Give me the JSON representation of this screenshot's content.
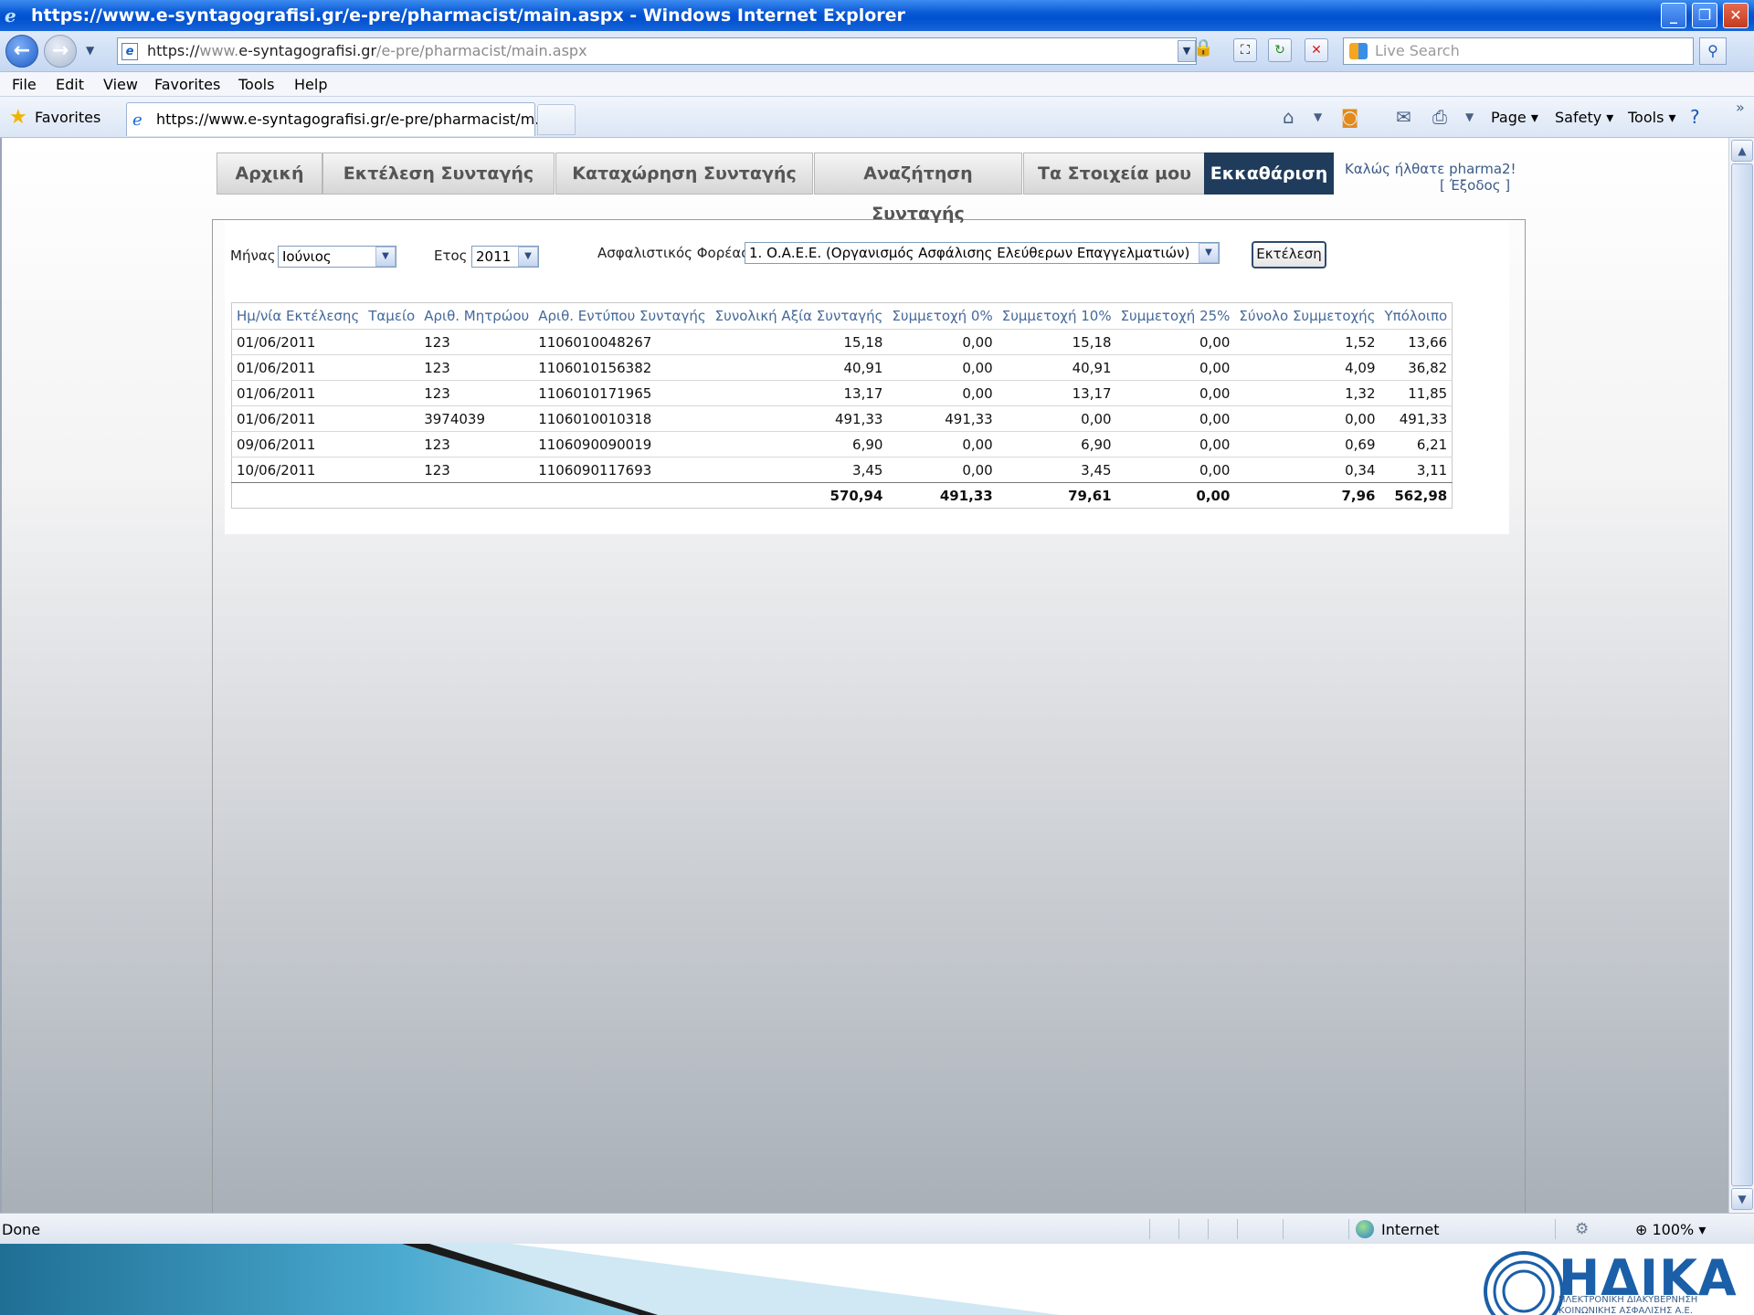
{
  "window": {
    "title": "https://www.e-syntagografisi.gr/e-pre/pharmacist/main.aspx - Windows Internet Explorer"
  },
  "address": {
    "scheme": "https://",
    "host": "www.e-syntagografisi.gr",
    "path": "/e-pre/pharmacist/main.aspx"
  },
  "search": {
    "placeholder": "Live Search"
  },
  "menu": [
    "File",
    "Edit",
    "View",
    "Favorites",
    "Tools",
    "Help"
  ],
  "favorites": {
    "label": "Favorites",
    "tab_title": "https://www.e-syntagografisi.gr/e-pre/pharmacist/m..."
  },
  "commandbar": {
    "page": "Page ▾",
    "safety": "Safety ▾",
    "tools": "Tools ▾"
  },
  "app": {
    "tabs": [
      "Αρχική",
      "Εκτέλεση Συνταγής",
      "Καταχώρηση Συνταγής",
      "Αναζήτηση Συνταγής",
      "Τα Στοιχεία μου",
      "Εκκαθάριση"
    ],
    "active_tab": "Εκκαθάριση",
    "welcome": "Καλώς ήλθατε pharma2!",
    "logout": "[ Έξοδος ]"
  },
  "filters": {
    "month_label": "Μήνας",
    "month_value": "Ιούνιος",
    "year_label": "Ετος",
    "year_value": "2011",
    "insurer_label": "Ασφαλιστικός Φορέας",
    "insurer_value": "1. Ο.Α.Ε.Ε. (Οργανισμός Ασφάλισης Ελεύθερων Επαγγελματιών)",
    "execute_label": "Εκτέλεση"
  },
  "table": {
    "headers": [
      "Ημ/νία Εκτέλεσης",
      "Ταμείο",
      "Αριθ. Μητρώου",
      "Αριθ. Εντύπου Συνταγής",
      "Συνολική Αξία Συνταγής",
      "Συμμετοχή 0%",
      "Συμμετοχή 10%",
      "Συμμετοχή 25%",
      "Σύνολο Συμμετοχής",
      "Υπόλοιπο"
    ],
    "rows": [
      [
        "01/06/2011",
        "",
        "123",
        "1106010048267",
        "15,18",
        "0,00",
        "15,18",
        "0,00",
        "1,52",
        "13,66"
      ],
      [
        "01/06/2011",
        "",
        "123",
        "1106010156382",
        "40,91",
        "0,00",
        "40,91",
        "0,00",
        "4,09",
        "36,82"
      ],
      [
        "01/06/2011",
        "",
        "123",
        "1106010171965",
        "13,17",
        "0,00",
        "13,17",
        "0,00",
        "1,32",
        "11,85"
      ],
      [
        "01/06/2011",
        "",
        "3974039",
        "1106010010318",
        "491,33",
        "491,33",
        "0,00",
        "0,00",
        "0,00",
        "491,33"
      ],
      [
        "09/06/2011",
        "",
        "123",
        "1106090090019",
        "6,90",
        "0,00",
        "6,90",
        "0,00",
        "0,69",
        "6,21"
      ],
      [
        "10/06/2011",
        "",
        "123",
        "1106090117693",
        "3,45",
        "0,00",
        "3,45",
        "0,00",
        "0,34",
        "3,11"
      ]
    ],
    "totals": [
      "",
      "",
      "",
      "",
      "570,94",
      "491,33",
      "79,61",
      "0,00",
      "7,96",
      "562,98"
    ]
  },
  "status": {
    "text": "Done",
    "zone": "Internet",
    "zoom": "100%"
  },
  "footer": {
    "brand": "ΗΔΙΚΑ",
    "sub1": "ΗΛΕΚΤΡΟΝΙΚΗ ΔΙΑΚΥΒΕΡΝΗΣΗ",
    "sub2": "ΚΟΙΝΩΝΙΚΗΣ ΑΣΦΑΛΙΣΗΣ Α.Ε."
  }
}
